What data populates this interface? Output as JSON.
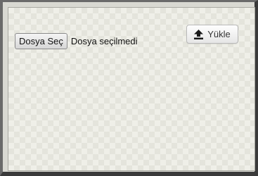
{
  "file_input": {
    "button_label": "Dosya Seç",
    "status_text": "Dosya seçilmedi"
  },
  "upload": {
    "label": "Yükle",
    "icon": "upload-icon"
  }
}
